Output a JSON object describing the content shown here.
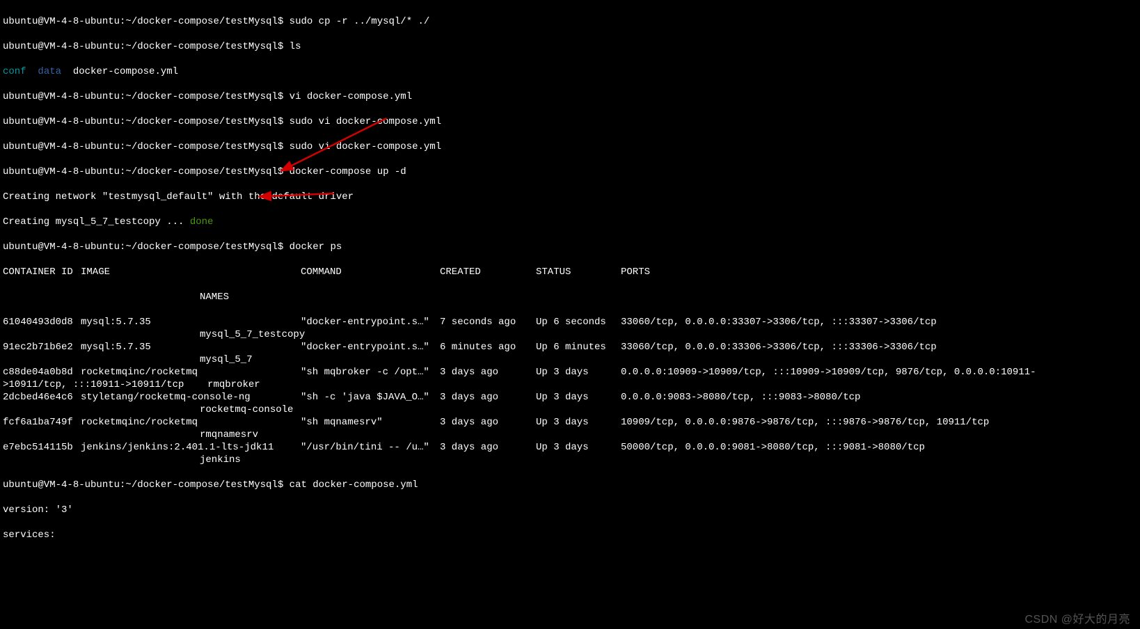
{
  "prompt": "ubuntu@VM-4-8-ubuntu:~/docker-compose/testMysql$",
  "cmds": {
    "cp": "sudo cp -r ../mysql/* ./",
    "ls": "ls",
    "vi1": "vi docker-compose.yml",
    "vi2": "sudo vi docker-compose.yml",
    "vi3": "sudo vi docker-compose.yml",
    "up": "docker-compose up -d",
    "ps": "docker ps",
    "cat": "cat docker-compose.yml"
  },
  "ls_out": {
    "conf": "conf",
    "data": "data",
    "file": "docker-compose.yml"
  },
  "up_out": {
    "net": "Creating network \"testmysql_default\" with the default driver",
    "create": "Creating mysql_5_7_testcopy ... ",
    "done": "done"
  },
  "ps": {
    "hdr": {
      "id": "CONTAINER ID",
      "image": "IMAGE",
      "names_lbl": "NAMES",
      "cmd": "COMMAND",
      "created": "CREATED",
      "status": "STATUS",
      "ports": "PORTS"
    },
    "rows": [
      {
        "id": "61040493d0d8",
        "image": "mysql:5.7.35",
        "name": "mysql_5_7_testcopy",
        "cmd": "\"docker-entrypoint.s…\"",
        "created": "7 seconds ago",
        "status": "Up 6 seconds",
        "ports": "33060/tcp, 0.0.0.0:33307->3306/tcp, :::33307->3306/tcp"
      },
      {
        "id": "91ec2b71b6e2",
        "image": "mysql:5.7.35",
        "name": "mysql_5_7",
        "cmd": "\"docker-entrypoint.s…\"",
        "created": "6 minutes ago",
        "status": "Up 6 minutes",
        "ports": "33060/tcp, 0.0.0.0:33306->3306/tcp, :::33306->3306/tcp"
      },
      {
        "id": "c88de04a0b8d",
        "image": "rocketmqinc/rocketmq",
        "name": "rmqbroker",
        "cmd": "\"sh mqbroker -c /opt…\"",
        "created": "3 days ago",
        "status": "Up 3 days",
        "ports": "0.0.0.0:10909->10909/tcp, :::10909->10909/tcp, 9876/tcp, 0.0.0.0:10911->10911/tcp, :::10911->10911/tcp"
      },
      {
        "id": "2dcbed46e4c6",
        "image": "styletang/rocketmq-console-ng",
        "name": "rocketmq-console",
        "cmd": "\"sh -c 'java $JAVA_O…\"",
        "created": "3 days ago",
        "status": "Up 3 days",
        "ports": "0.0.0.0:9083->8080/tcp, :::9083->8080/tcp"
      },
      {
        "id": "fcf6a1ba749f",
        "image": "rocketmqinc/rocketmq",
        "name": "rmqnamesrv",
        "cmd": "\"sh mqnamesrv\"",
        "created": "3 days ago",
        "status": "Up 3 days",
        "ports": "10909/tcp, 0.0.0.0:9876->9876/tcp, :::9876->9876/tcp, 10911/tcp"
      },
      {
        "id": "e7ebc514115b",
        "image": "jenkins/jenkins:2.401.1-lts-jdk11",
        "name": "jenkins",
        "cmd": "\"/usr/bin/tini -- /u…\"",
        "created": "3 days ago",
        "status": "Up 3 days",
        "ports": "50000/tcp, 0.0.0.0:9081->8080/tcp, :::9081->8080/tcp"
      }
    ]
  },
  "cat_out": {
    "version": "version: '3'",
    "services": "services:"
  },
  "watermark": "CSDN @好大的月亮"
}
